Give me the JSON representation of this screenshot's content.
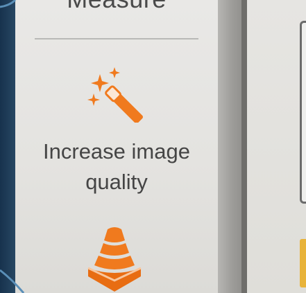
{
  "toolbar": {
    "measure_label": "Measure",
    "increase_quality": {
      "line1": "Increase image",
      "line2": "quality",
      "icon": "magic-wand-icon"
    },
    "next_item_icon": "cone-layers-icon"
  },
  "colors": {
    "accent_orange": "#f07a1e",
    "panel_bg": "#e7e6e3",
    "text": "#454545"
  }
}
